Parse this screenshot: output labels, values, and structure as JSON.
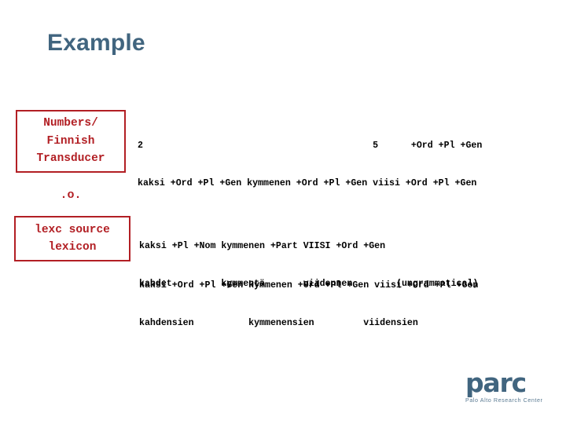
{
  "slide": {
    "title": "Example",
    "title_color": "#41657f",
    "background_color": "#ffffff"
  },
  "diagram": {
    "accent_color": "#b21f24",
    "compose_operator": ".o.",
    "boxes": [
      {
        "name": "numbers-finnish-transducer",
        "lines": [
          "Numbers/",
          "Finnish",
          "Transducer"
        ]
      },
      {
        "name": "lexc-source-lexicon",
        "lines": [
          "lexc source",
          "lexicon"
        ]
      }
    ]
  },
  "analyses": {
    "top": {
      "surface_row": "2                                          5      +Ord +Pl +Gen",
      "lexical_row": "kaksi +Ord +Pl +Gen kymmenen +Ord +Pl +Gen viisi +Ord +Pl +Gen"
    },
    "middle": {
      "lexical_row": "kaksi +Pl +Nom kymmenen +Part VIISI +Ord +Gen",
      "surface_row": "kahdet         kymmentä       viidennen        (ungrammatical)"
    },
    "lower": {
      "lexical_row": "kaksi +Ord +Pl +Gen kymmenen +Ord +Pl +Gen viisi +Ord +Pl +Gen",
      "surface_row": "kahdensien          kymmenensien         viidensien"
    }
  },
  "logo": {
    "wordmark": "parc",
    "tagline": "Palo Alto Research Center",
    "color": "#41657f"
  }
}
